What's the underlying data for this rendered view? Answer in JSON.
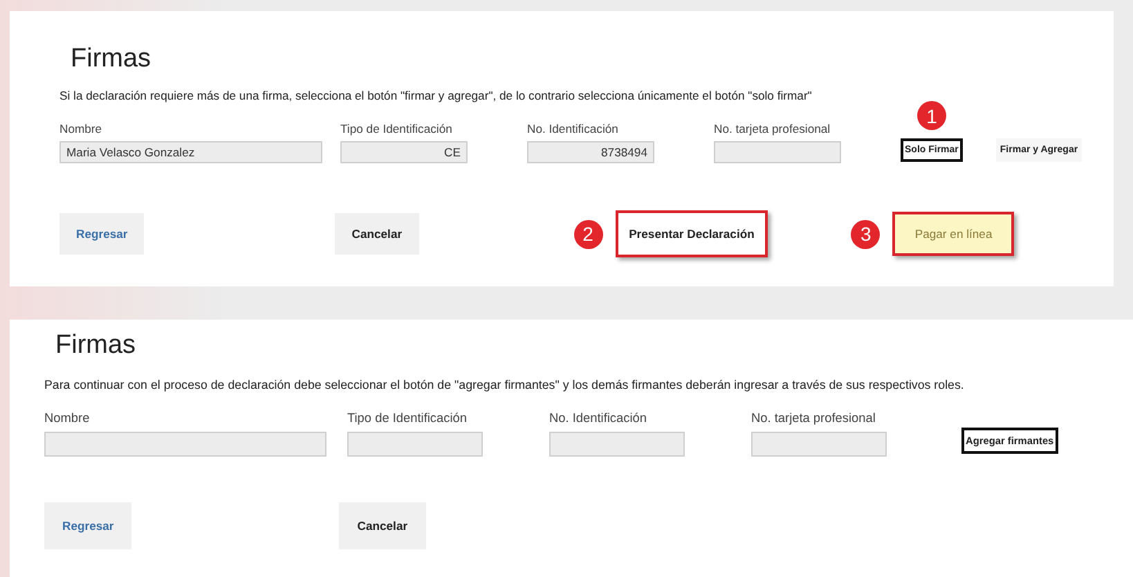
{
  "panels": [
    {
      "title": "Firmas",
      "description": "Si la declaración requiere más de una firma, selecciona el botón \"firmar y agregar\", de lo contrario selecciona únicamente el botón \"solo firmar\"",
      "fields": [
        {
          "label": "Nombre",
          "value": "Maria Velasco Gonzalez"
        },
        {
          "label": "Tipo de Identificación",
          "value": "CE"
        },
        {
          "label": "No. Identificación",
          "value": "8738494"
        },
        {
          "label": "No. tarjeta profesional"
        }
      ],
      "actions": [
        {
          "label": "Solo Firmar",
          "highlighted": true,
          "color": "#111111",
          "badge": "1"
        },
        {
          "label": "Firmar y Agregar",
          "highlighted": false
        }
      ],
      "buttons": [
        {
          "label": "Regresar",
          "kind": "link",
          "highlighted": false
        },
        {
          "label": "Cancelar",
          "kind": "plain",
          "highlighted": false
        },
        {
          "label": "Presentar Declaración",
          "kind": "plain",
          "highlighted": true,
          "color": "#d9262c",
          "badge": "2"
        },
        {
          "label": "Pagar en línea",
          "kind": "pay",
          "highlighted": true,
          "color": "#d9262c",
          "badge": "3"
        }
      ]
    },
    {
      "title": "Firmas",
      "description": "Para continuar con el proceso de declaración debe seleccionar el botón de \"agregar firmantes\" y los demás firmantes deberán ingresar a través de sus respectivos roles.",
      "fields": [
        {
          "label": "Nombre"
        },
        {
          "label": "Tipo de Identificación"
        },
        {
          "label": "No. Identificación"
        },
        {
          "label": "No. tarjeta profesional"
        }
      ],
      "actions": [
        {
          "label": "Agregar firmantes",
          "highlighted": true,
          "color": "#111111"
        }
      ],
      "buttons": [
        {
          "label": "Regresar",
          "kind": "link",
          "highlighted": false
        },
        {
          "label": "Cancelar",
          "kind": "plain",
          "highlighted": false
        }
      ]
    }
  ]
}
